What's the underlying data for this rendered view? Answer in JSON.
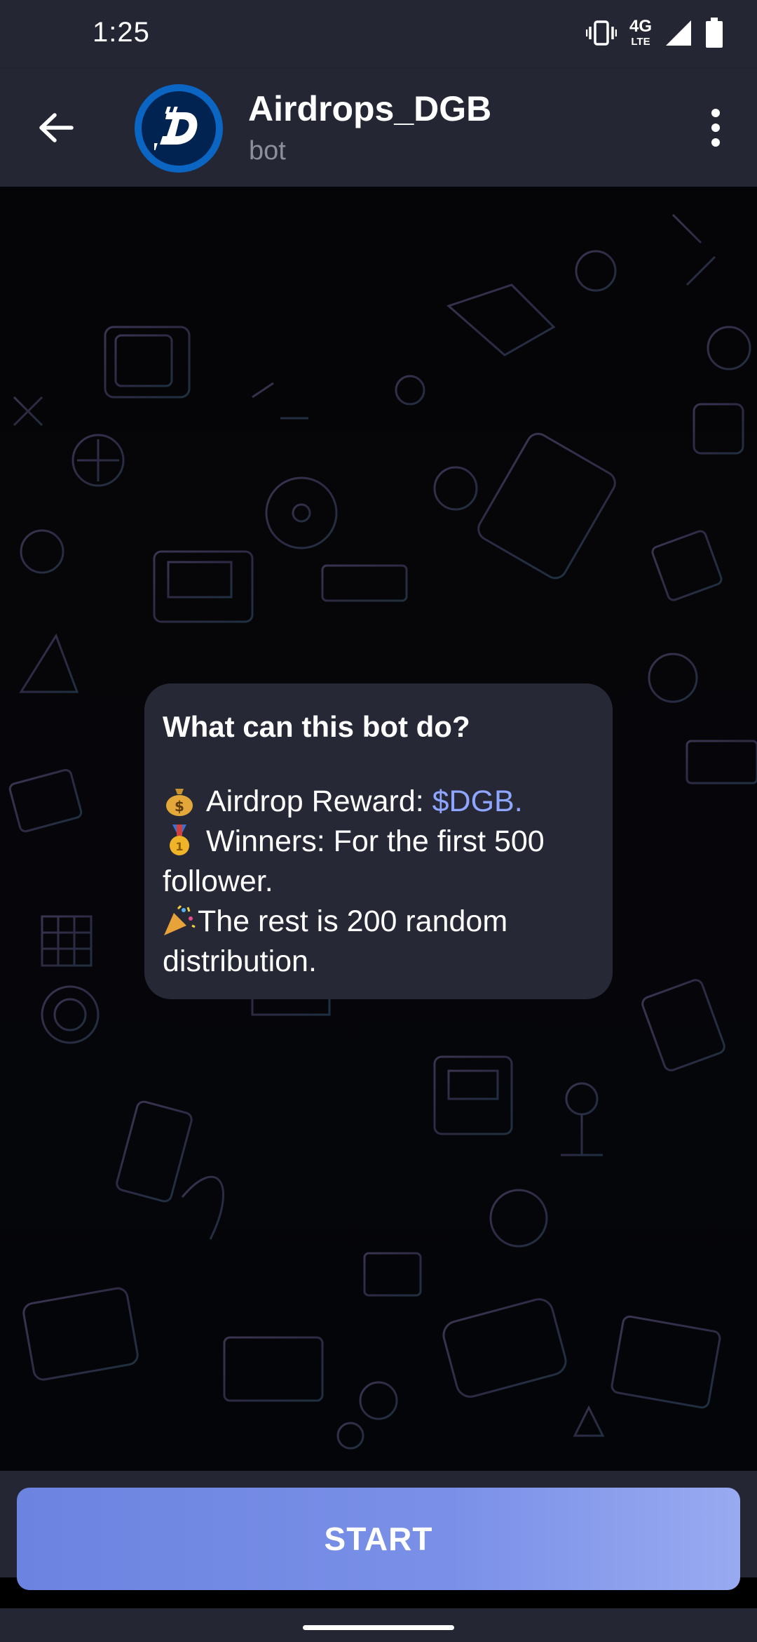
{
  "status_bar": {
    "time": "1:25",
    "network_top": "4G",
    "network_bottom": "LTE",
    "icons": [
      "vibrate-icon",
      "signal-icon",
      "battery-icon"
    ]
  },
  "header": {
    "title": "Airdrops_DGB",
    "subtitle": "bot",
    "back_icon": "arrow-left-icon",
    "menu_icon": "more-vertical-icon",
    "avatar_letter": "D"
  },
  "bot_info": {
    "title": "What can this bot do?",
    "reward_label": "Airdrop Reward: ",
    "reward_value": "$DGB.",
    "winners_text": "Winners: For the first 500",
    "winners_cont": "follower.",
    "rest_text": "The rest is 200 random",
    "rest_cont": "distribution.",
    "emojis": [
      "money-bag-icon",
      "first-place-medal-icon",
      "party-popper-icon"
    ]
  },
  "start_button": {
    "label": "START"
  },
  "colors": {
    "bar": "#242634",
    "bubble": "#262836",
    "accent": "#8ea6ff",
    "button": "#7a90e8"
  }
}
